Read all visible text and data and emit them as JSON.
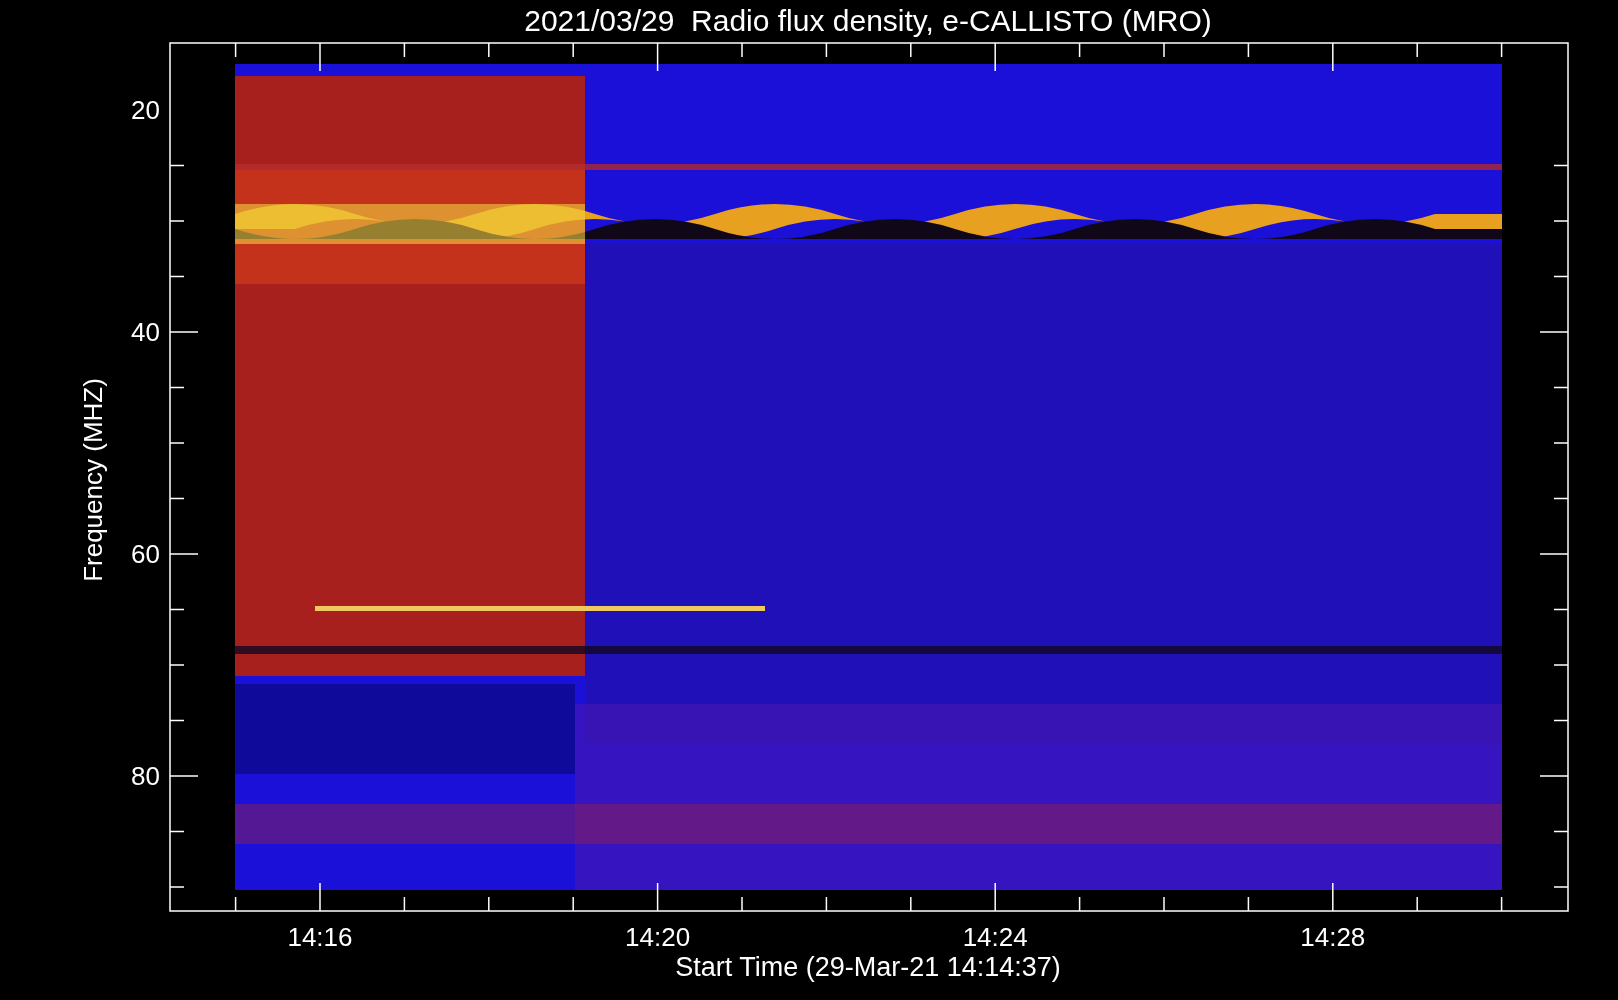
{
  "title": "2021/03/29  Radio flux density, e-CALLISTO (MRO)",
  "xlabel": "Start Time (29-Mar-21 14:14:37)",
  "ylabel": "Frequency (MHZ)",
  "xticks": [
    "14:16",
    "14:20",
    "14:24",
    "14:28"
  ],
  "yticks": [
    "20",
    "40",
    "60",
    "80"
  ]
}
